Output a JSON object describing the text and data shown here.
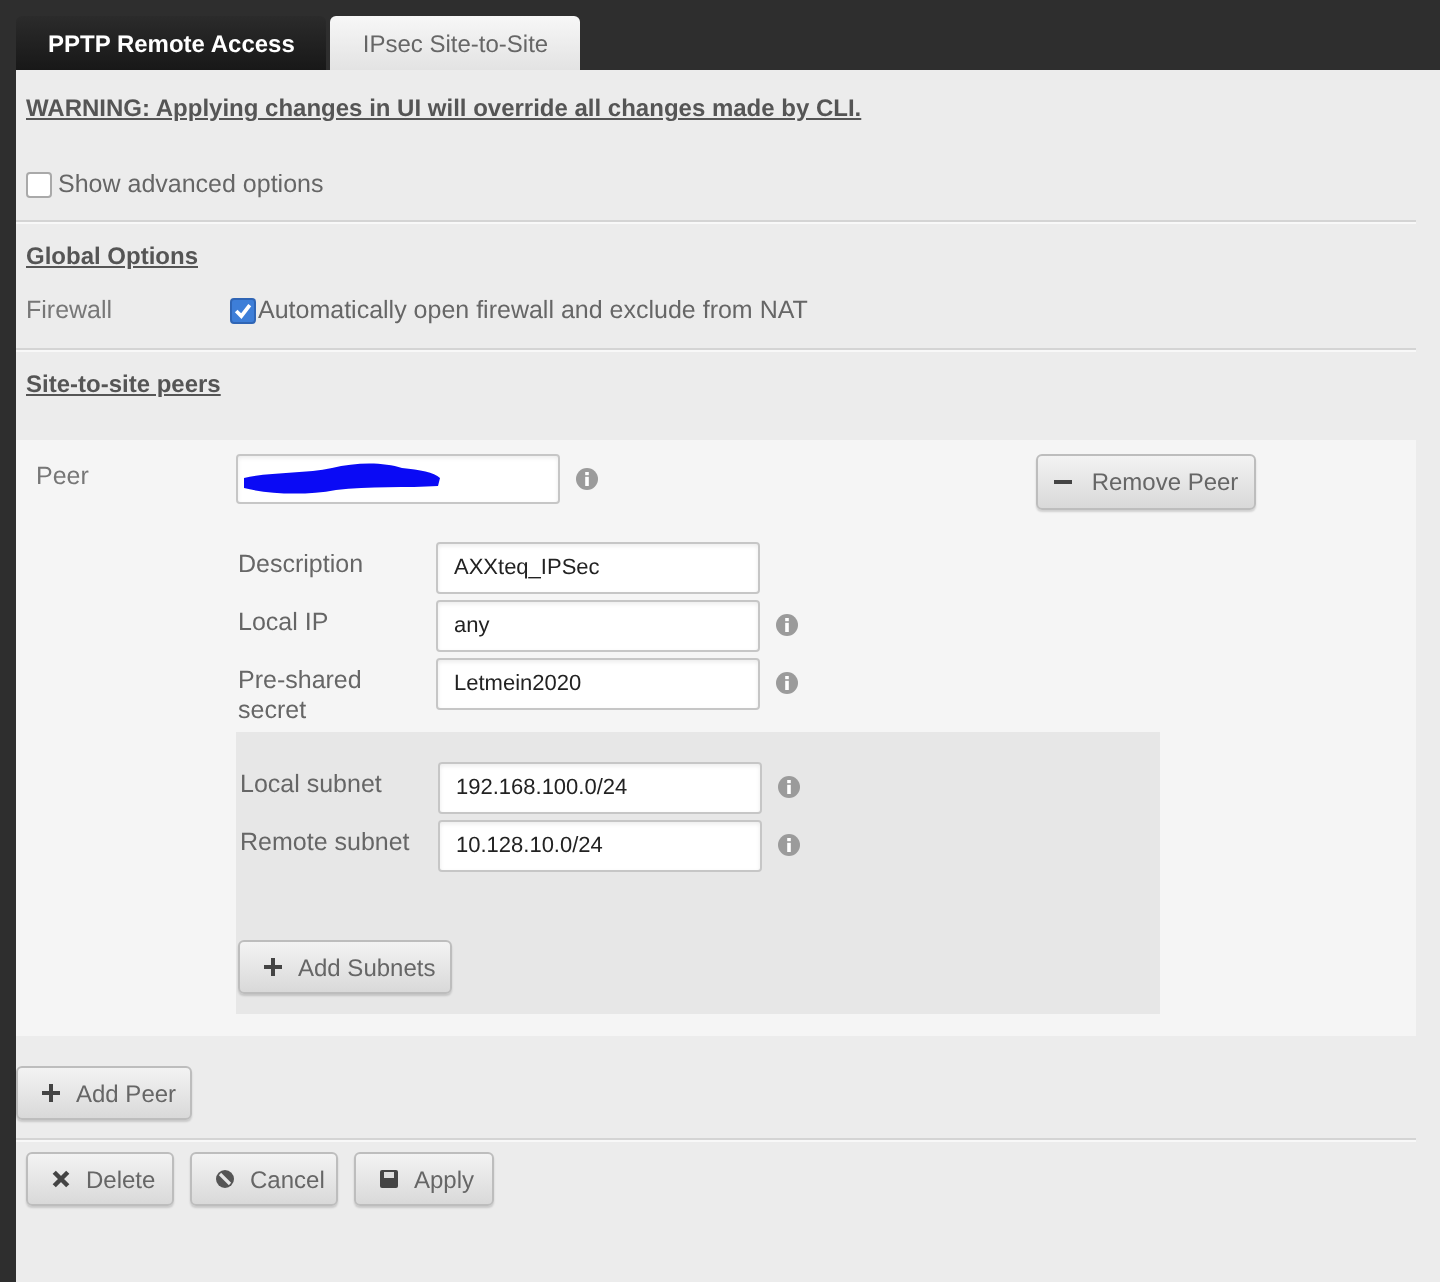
{
  "tabs": [
    {
      "label": "PPTP Remote Access",
      "selected": false
    },
    {
      "label": "IPsec Site-to-Site",
      "selected": true
    }
  ],
  "warning": "WARNING: Applying changes in UI will override all changes made by CLI.",
  "advanced_options": {
    "label": "Show advanced options",
    "checked": false
  },
  "global_options": {
    "heading": "Global Options",
    "firewall": {
      "label": "Firewall",
      "option": "Automatically open firewall and exclude from NAT",
      "checked": true
    }
  },
  "peers_section": {
    "heading": "Site-to-site peers",
    "peers": [
      {
        "label": "Peer",
        "redacted": true,
        "info": true,
        "remove_button": "Remove Peer",
        "fields": [
          {
            "label": "Description",
            "value": "AXXteq_IPSec",
            "info": false
          },
          {
            "label": "Local IP",
            "value": "any",
            "info": true
          },
          {
            "label": "Pre-shared secret",
            "value": "Letmein2020",
            "info": true
          }
        ],
        "subnets": [
          {
            "label": "Local subnet",
            "value": "192.168.100.0/24",
            "info": true
          },
          {
            "label": "Remote subnet",
            "value": "10.128.10.0/24",
            "info": true
          }
        ],
        "add_subnets_button": "Add Subnets"
      }
    ],
    "add_peer_button": "Add Peer"
  },
  "actions": [
    {
      "label": "Delete",
      "kind": "delete"
    },
    {
      "label": "Cancel",
      "kind": "cancel"
    },
    {
      "label": "Apply",
      "kind": "apply"
    }
  ]
}
